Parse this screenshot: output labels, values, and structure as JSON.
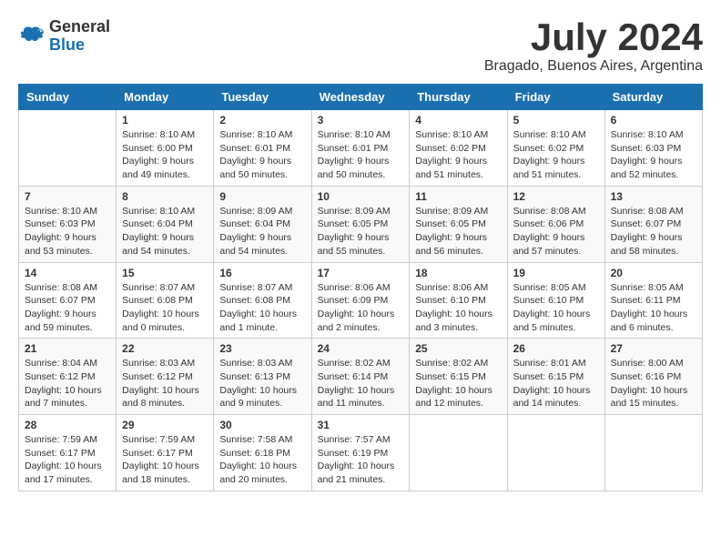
{
  "header": {
    "logo_general": "General",
    "logo_blue": "Blue",
    "month_title": "July 2024",
    "location": "Bragado, Buenos Aires, Argentina"
  },
  "calendar": {
    "columns": [
      "Sunday",
      "Monday",
      "Tuesday",
      "Wednesday",
      "Thursday",
      "Friday",
      "Saturday"
    ],
    "weeks": [
      [
        {
          "day": "",
          "sunrise": "",
          "sunset": "",
          "daylight": ""
        },
        {
          "day": "1",
          "sunrise": "Sunrise: 8:10 AM",
          "sunset": "Sunset: 6:00 PM",
          "daylight": "Daylight: 9 hours and 49 minutes."
        },
        {
          "day": "2",
          "sunrise": "Sunrise: 8:10 AM",
          "sunset": "Sunset: 6:01 PM",
          "daylight": "Daylight: 9 hours and 50 minutes."
        },
        {
          "day": "3",
          "sunrise": "Sunrise: 8:10 AM",
          "sunset": "Sunset: 6:01 PM",
          "daylight": "Daylight: 9 hours and 50 minutes."
        },
        {
          "day": "4",
          "sunrise": "Sunrise: 8:10 AM",
          "sunset": "Sunset: 6:02 PM",
          "daylight": "Daylight: 9 hours and 51 minutes."
        },
        {
          "day": "5",
          "sunrise": "Sunrise: 8:10 AM",
          "sunset": "Sunset: 6:02 PM",
          "daylight": "Daylight: 9 hours and 51 minutes."
        },
        {
          "day": "6",
          "sunrise": "Sunrise: 8:10 AM",
          "sunset": "Sunset: 6:03 PM",
          "daylight": "Daylight: 9 hours and 52 minutes."
        }
      ],
      [
        {
          "day": "7",
          "sunrise": "Sunrise: 8:10 AM",
          "sunset": "Sunset: 6:03 PM",
          "daylight": "Daylight: 9 hours and 53 minutes."
        },
        {
          "day": "8",
          "sunrise": "Sunrise: 8:10 AM",
          "sunset": "Sunset: 6:04 PM",
          "daylight": "Daylight: 9 hours and 54 minutes."
        },
        {
          "day": "9",
          "sunrise": "Sunrise: 8:09 AM",
          "sunset": "Sunset: 6:04 PM",
          "daylight": "Daylight: 9 hours and 54 minutes."
        },
        {
          "day": "10",
          "sunrise": "Sunrise: 8:09 AM",
          "sunset": "Sunset: 6:05 PM",
          "daylight": "Daylight: 9 hours and 55 minutes."
        },
        {
          "day": "11",
          "sunrise": "Sunrise: 8:09 AM",
          "sunset": "Sunset: 6:05 PM",
          "daylight": "Daylight: 9 hours and 56 minutes."
        },
        {
          "day": "12",
          "sunrise": "Sunrise: 8:08 AM",
          "sunset": "Sunset: 6:06 PM",
          "daylight": "Daylight: 9 hours and 57 minutes."
        },
        {
          "day": "13",
          "sunrise": "Sunrise: 8:08 AM",
          "sunset": "Sunset: 6:07 PM",
          "daylight": "Daylight: 9 hours and 58 minutes."
        }
      ],
      [
        {
          "day": "14",
          "sunrise": "Sunrise: 8:08 AM",
          "sunset": "Sunset: 6:07 PM",
          "daylight": "Daylight: 9 hours and 59 minutes."
        },
        {
          "day": "15",
          "sunrise": "Sunrise: 8:07 AM",
          "sunset": "Sunset: 6:08 PM",
          "daylight": "Daylight: 10 hours and 0 minutes."
        },
        {
          "day": "16",
          "sunrise": "Sunrise: 8:07 AM",
          "sunset": "Sunset: 6:08 PM",
          "daylight": "Daylight: 10 hours and 1 minute."
        },
        {
          "day": "17",
          "sunrise": "Sunrise: 8:06 AM",
          "sunset": "Sunset: 6:09 PM",
          "daylight": "Daylight: 10 hours and 2 minutes."
        },
        {
          "day": "18",
          "sunrise": "Sunrise: 8:06 AM",
          "sunset": "Sunset: 6:10 PM",
          "daylight": "Daylight: 10 hours and 3 minutes."
        },
        {
          "day": "19",
          "sunrise": "Sunrise: 8:05 AM",
          "sunset": "Sunset: 6:10 PM",
          "daylight": "Daylight: 10 hours and 5 minutes."
        },
        {
          "day": "20",
          "sunrise": "Sunrise: 8:05 AM",
          "sunset": "Sunset: 6:11 PM",
          "daylight": "Daylight: 10 hours and 6 minutes."
        }
      ],
      [
        {
          "day": "21",
          "sunrise": "Sunrise: 8:04 AM",
          "sunset": "Sunset: 6:12 PM",
          "daylight": "Daylight: 10 hours and 7 minutes."
        },
        {
          "day": "22",
          "sunrise": "Sunrise: 8:03 AM",
          "sunset": "Sunset: 6:12 PM",
          "daylight": "Daylight: 10 hours and 8 minutes."
        },
        {
          "day": "23",
          "sunrise": "Sunrise: 8:03 AM",
          "sunset": "Sunset: 6:13 PM",
          "daylight": "Daylight: 10 hours and 9 minutes."
        },
        {
          "day": "24",
          "sunrise": "Sunrise: 8:02 AM",
          "sunset": "Sunset: 6:14 PM",
          "daylight": "Daylight: 10 hours and 11 minutes."
        },
        {
          "day": "25",
          "sunrise": "Sunrise: 8:02 AM",
          "sunset": "Sunset: 6:15 PM",
          "daylight": "Daylight: 10 hours and 12 minutes."
        },
        {
          "day": "26",
          "sunrise": "Sunrise: 8:01 AM",
          "sunset": "Sunset: 6:15 PM",
          "daylight": "Daylight: 10 hours and 14 minutes."
        },
        {
          "day": "27",
          "sunrise": "Sunrise: 8:00 AM",
          "sunset": "Sunset: 6:16 PM",
          "daylight": "Daylight: 10 hours and 15 minutes."
        }
      ],
      [
        {
          "day": "28",
          "sunrise": "Sunrise: 7:59 AM",
          "sunset": "Sunset: 6:17 PM",
          "daylight": "Daylight: 10 hours and 17 minutes."
        },
        {
          "day": "29",
          "sunrise": "Sunrise: 7:59 AM",
          "sunset": "Sunset: 6:17 PM",
          "daylight": "Daylight: 10 hours and 18 minutes."
        },
        {
          "day": "30",
          "sunrise": "Sunrise: 7:58 AM",
          "sunset": "Sunset: 6:18 PM",
          "daylight": "Daylight: 10 hours and 20 minutes."
        },
        {
          "day": "31",
          "sunrise": "Sunrise: 7:57 AM",
          "sunset": "Sunset: 6:19 PM",
          "daylight": "Daylight: 10 hours and 21 minutes."
        },
        {
          "day": "",
          "sunrise": "",
          "sunset": "",
          "daylight": ""
        },
        {
          "day": "",
          "sunrise": "",
          "sunset": "",
          "daylight": ""
        },
        {
          "day": "",
          "sunrise": "",
          "sunset": "",
          "daylight": ""
        }
      ]
    ]
  }
}
